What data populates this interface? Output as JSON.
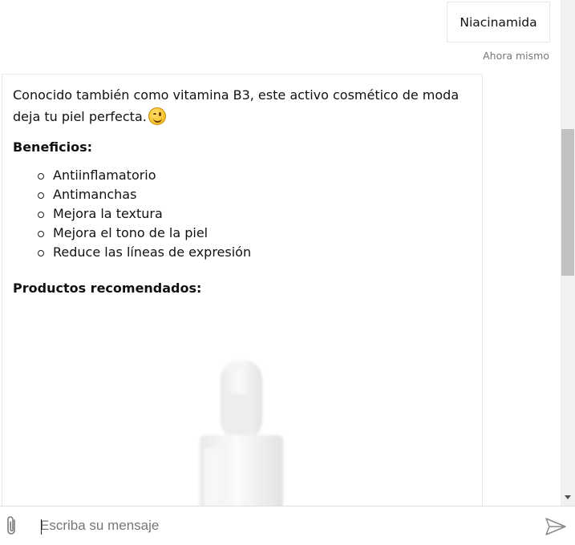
{
  "user_message": {
    "text": "Niacinamida",
    "timestamp": "Ahora mismo"
  },
  "bot_message": {
    "intro": "Conocido también como vitamina B3, este activo cosmético de moda deja tu piel perfecta.",
    "emoji": "winking-face",
    "benefits_title": "Beneficios:",
    "benefits": [
      "Antiinflamatorio",
      "Antimanchas",
      "Mejora la textura",
      "Mejora el tono de la piel",
      "Reduce las líneas de expresión"
    ],
    "products_title": "Productos recomendados:",
    "product_image": "dropper-bottle"
  },
  "input": {
    "placeholder": "Escriba su mensaje",
    "value": ""
  },
  "icons": {
    "attach": "paperclip-icon",
    "send": "send-icon",
    "scroll_down": "chevron-down-icon"
  },
  "colors": {
    "border": "#e6e6e6",
    "timestamp": "#767676",
    "scroll_thumb": "#c1c1c1"
  }
}
